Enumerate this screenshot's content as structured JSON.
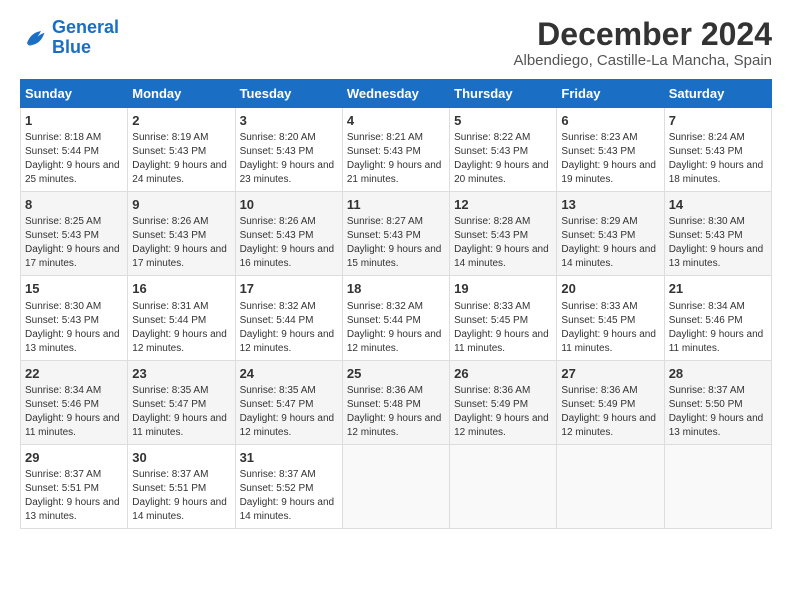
{
  "logo": {
    "line1": "General",
    "line2": "Blue"
  },
  "title": "December 2024",
  "location": "Albendiego, Castille-La Mancha, Spain",
  "days_of_week": [
    "Sunday",
    "Monday",
    "Tuesday",
    "Wednesday",
    "Thursday",
    "Friday",
    "Saturday"
  ],
  "weeks": [
    [
      {
        "day": 1,
        "sunrise": "8:18 AM",
        "sunset": "5:44 PM",
        "daylight": "9 hours and 25 minutes."
      },
      {
        "day": 2,
        "sunrise": "8:19 AM",
        "sunset": "5:43 PM",
        "daylight": "9 hours and 24 minutes."
      },
      {
        "day": 3,
        "sunrise": "8:20 AM",
        "sunset": "5:43 PM",
        "daylight": "9 hours and 23 minutes."
      },
      {
        "day": 4,
        "sunrise": "8:21 AM",
        "sunset": "5:43 PM",
        "daylight": "9 hours and 21 minutes."
      },
      {
        "day": 5,
        "sunrise": "8:22 AM",
        "sunset": "5:43 PM",
        "daylight": "9 hours and 20 minutes."
      },
      {
        "day": 6,
        "sunrise": "8:23 AM",
        "sunset": "5:43 PM",
        "daylight": "9 hours and 19 minutes."
      },
      {
        "day": 7,
        "sunrise": "8:24 AM",
        "sunset": "5:43 PM",
        "daylight": "9 hours and 18 minutes."
      }
    ],
    [
      {
        "day": 8,
        "sunrise": "8:25 AM",
        "sunset": "5:43 PM",
        "daylight": "9 hours and 17 minutes."
      },
      {
        "day": 9,
        "sunrise": "8:26 AM",
        "sunset": "5:43 PM",
        "daylight": "9 hours and 17 minutes."
      },
      {
        "day": 10,
        "sunrise": "8:26 AM",
        "sunset": "5:43 PM",
        "daylight": "9 hours and 16 minutes."
      },
      {
        "day": 11,
        "sunrise": "8:27 AM",
        "sunset": "5:43 PM",
        "daylight": "9 hours and 15 minutes."
      },
      {
        "day": 12,
        "sunrise": "8:28 AM",
        "sunset": "5:43 PM",
        "daylight": "9 hours and 14 minutes."
      },
      {
        "day": 13,
        "sunrise": "8:29 AM",
        "sunset": "5:43 PM",
        "daylight": "9 hours and 14 minutes."
      },
      {
        "day": 14,
        "sunrise": "8:30 AM",
        "sunset": "5:43 PM",
        "daylight": "9 hours and 13 minutes."
      }
    ],
    [
      {
        "day": 15,
        "sunrise": "8:30 AM",
        "sunset": "5:43 PM",
        "daylight": "9 hours and 13 minutes."
      },
      {
        "day": 16,
        "sunrise": "8:31 AM",
        "sunset": "5:44 PM",
        "daylight": "9 hours and 12 minutes."
      },
      {
        "day": 17,
        "sunrise": "8:32 AM",
        "sunset": "5:44 PM",
        "daylight": "9 hours and 12 minutes."
      },
      {
        "day": 18,
        "sunrise": "8:32 AM",
        "sunset": "5:44 PM",
        "daylight": "9 hours and 12 minutes."
      },
      {
        "day": 19,
        "sunrise": "8:33 AM",
        "sunset": "5:45 PM",
        "daylight": "9 hours and 11 minutes."
      },
      {
        "day": 20,
        "sunrise": "8:33 AM",
        "sunset": "5:45 PM",
        "daylight": "9 hours and 11 minutes."
      },
      {
        "day": 21,
        "sunrise": "8:34 AM",
        "sunset": "5:46 PM",
        "daylight": "9 hours and 11 minutes."
      }
    ],
    [
      {
        "day": 22,
        "sunrise": "8:34 AM",
        "sunset": "5:46 PM",
        "daylight": "9 hours and 11 minutes."
      },
      {
        "day": 23,
        "sunrise": "8:35 AM",
        "sunset": "5:47 PM",
        "daylight": "9 hours and 11 minutes."
      },
      {
        "day": 24,
        "sunrise": "8:35 AM",
        "sunset": "5:47 PM",
        "daylight": "9 hours and 12 minutes."
      },
      {
        "day": 25,
        "sunrise": "8:36 AM",
        "sunset": "5:48 PM",
        "daylight": "9 hours and 12 minutes."
      },
      {
        "day": 26,
        "sunrise": "8:36 AM",
        "sunset": "5:49 PM",
        "daylight": "9 hours and 12 minutes."
      },
      {
        "day": 27,
        "sunrise": "8:36 AM",
        "sunset": "5:49 PM",
        "daylight": "9 hours and 12 minutes."
      },
      {
        "day": 28,
        "sunrise": "8:37 AM",
        "sunset": "5:50 PM",
        "daylight": "9 hours and 13 minutes."
      }
    ],
    [
      {
        "day": 29,
        "sunrise": "8:37 AM",
        "sunset": "5:51 PM",
        "daylight": "9 hours and 13 minutes."
      },
      {
        "day": 30,
        "sunrise": "8:37 AM",
        "sunset": "5:51 PM",
        "daylight": "9 hours and 14 minutes."
      },
      {
        "day": 31,
        "sunrise": "8:37 AM",
        "sunset": "5:52 PM",
        "daylight": "9 hours and 14 minutes."
      },
      null,
      null,
      null,
      null
    ]
  ]
}
